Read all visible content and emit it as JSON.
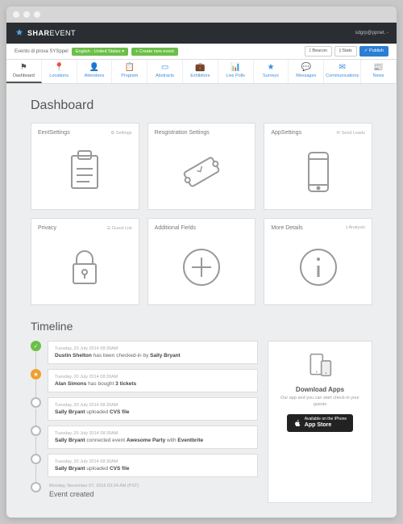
{
  "brand": {
    "bold": "SHAR",
    "thin": "EVENT"
  },
  "user": "sdgrp@ppnet. -",
  "crumbs": {
    "event": "Evento di prova SYSppel",
    "lang": "English - United States ▾",
    "create": "+ Create new event"
  },
  "topbtns": {
    "beacon": "⟟ Beacon",
    "stats": "⫾ Stats",
    "publish": "✓ Publish"
  },
  "tabs": [
    {
      "icon": "⚑",
      "label": "Dashboard",
      "active": true
    },
    {
      "icon": "📍",
      "label": "Locations"
    },
    {
      "icon": "👤",
      "label": "Attendees"
    },
    {
      "icon": "📋",
      "label": "Program"
    },
    {
      "icon": "▭",
      "label": "Abstracts"
    },
    {
      "icon": "💼",
      "label": "Exhibitors"
    },
    {
      "icon": "📊",
      "label": "Live Polls"
    },
    {
      "icon": "★",
      "label": "Surveys"
    },
    {
      "icon": "💬",
      "label": "Messages"
    },
    {
      "icon": "✉",
      "label": "Communications"
    },
    {
      "icon": "📰",
      "label": "News"
    }
  ],
  "dashboard_title": "Dashboard",
  "cards": [
    {
      "title": "EentSettings",
      "action": "⚙ Settings",
      "icon": "clipboard"
    },
    {
      "title": "Resgistration Settings",
      "action": "",
      "icon": "ticket"
    },
    {
      "title": "AppSettings",
      "action": "✉ Send Leads",
      "icon": "phone"
    },
    {
      "title": "Privacy",
      "action": "☰ Guest List",
      "icon": "lock"
    },
    {
      "title": "Additional Fields",
      "action": "",
      "icon": "plus"
    },
    {
      "title": "More Details",
      "action": "⫾ Analysis",
      "icon": "info"
    }
  ],
  "timeline_title": "Timeline",
  "timeline": [
    {
      "color": "g",
      "time": "Tuesday, 20 July 2014 08:30AM",
      "html": "<b>Dustin Shelton</b> has been checked-in by <b>Sally Bryant</b>"
    },
    {
      "color": "o",
      "time": "Tuesday, 20 July 2014 08:30AM",
      "html": "<b>Alan Simons</b> has bought <b>3 tickets</b>"
    },
    {
      "color": "gr",
      "time": "Tuesday, 20 July 2014 08:30AM",
      "html": "<b>Sally Bryant</b> uploaded <b>CVS file</b>"
    },
    {
      "color": "gr",
      "time": "Tuesday, 20 July 2014 08:30AM",
      "html": "<b>Sally Bryant</b> connected event <b>Awesome Party</b> with <b>Eventbrite</b>"
    },
    {
      "color": "gr",
      "time": "Tuesday, 20 July 2014 08:30AM",
      "html": "<b>Sally Bryant</b> uploaded <b>CVS file</b>"
    },
    {
      "color": "gr",
      "plain": true,
      "time": "Monday, November 07, 2016 03:24 AM (PST)",
      "html": "Event created"
    }
  ],
  "download": {
    "title": "Download Apps",
    "desc": "Our app and you can start check-in your guests",
    "appstore_top": "Available on the iPhone",
    "appstore_big": "App Store"
  }
}
